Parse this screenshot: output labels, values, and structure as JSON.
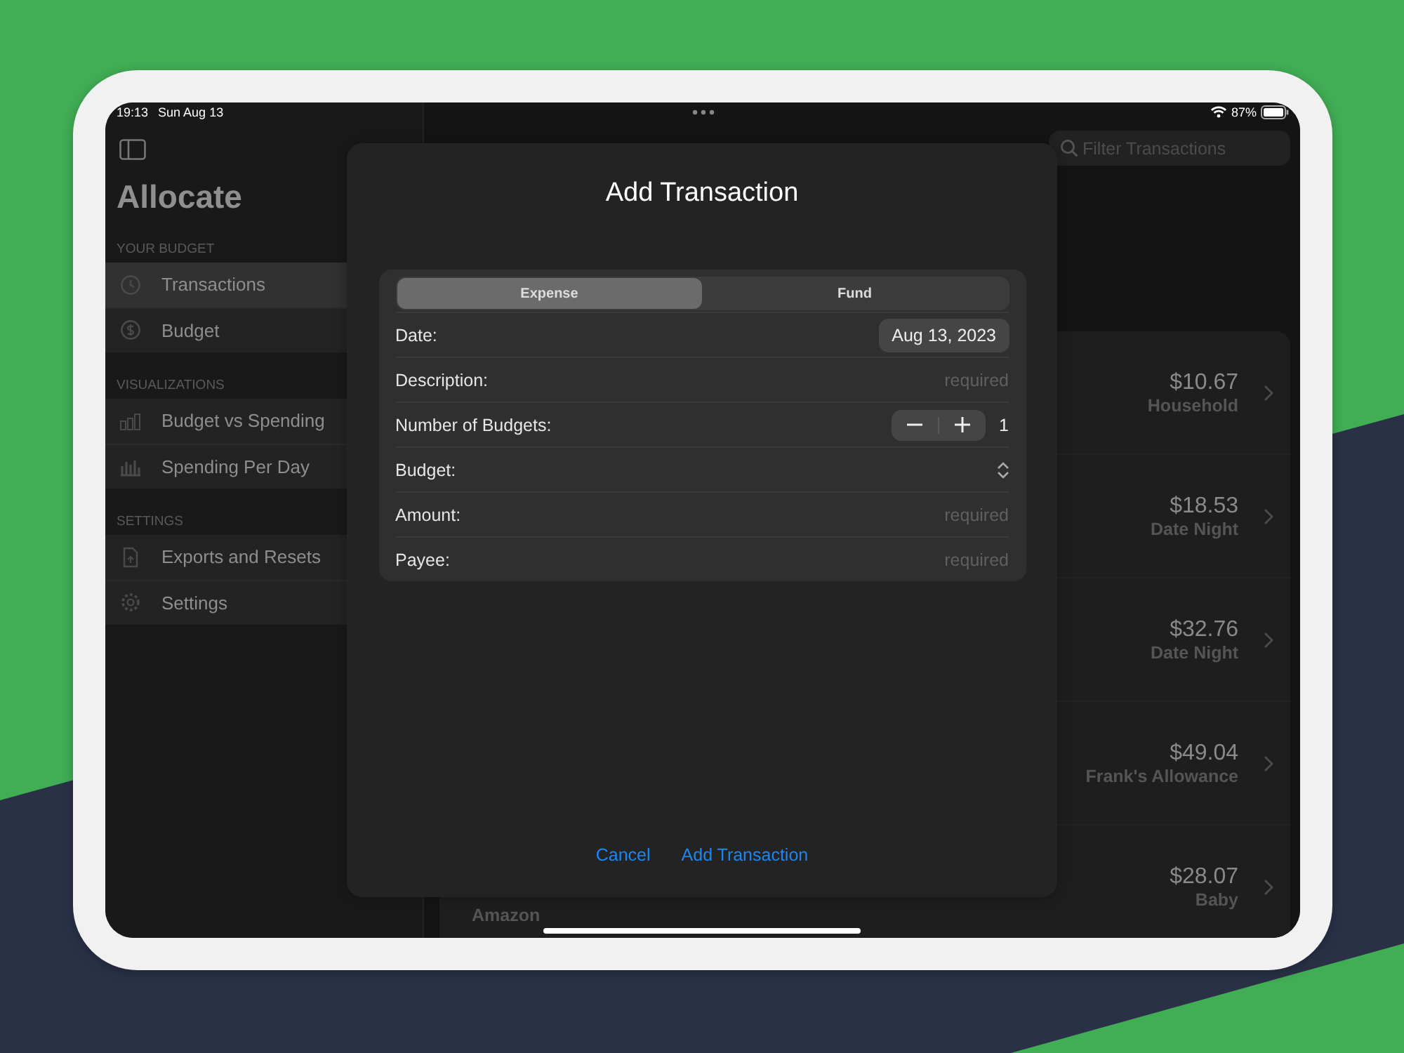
{
  "status_bar": {
    "time": "19:13",
    "date": "Sun Aug 13",
    "battery": "87%"
  },
  "sidebar": {
    "title": "Allocate",
    "sections": [
      {
        "header": "YOUR BUDGET",
        "items": [
          {
            "label": "Transactions",
            "selected": true
          },
          {
            "label": "Budget",
            "selected": false
          }
        ]
      },
      {
        "header": "VISUALIZATIONS",
        "items": [
          {
            "label": "Budget vs Spending",
            "selected": false
          },
          {
            "label": "Spending Per Day",
            "selected": false
          }
        ]
      },
      {
        "header": "SETTINGS",
        "items": [
          {
            "label": "Exports and Resets",
            "selected": false
          },
          {
            "label": "Settings",
            "selected": false
          }
        ]
      }
    ]
  },
  "search": {
    "placeholder": "Filter Transactions"
  },
  "transactions": [
    {
      "amount": "$10.67",
      "budget": "Household"
    },
    {
      "amount": "$18.53",
      "budget": "Date Night"
    },
    {
      "amount": "$32.76",
      "budget": "Date Night"
    },
    {
      "amount": "$49.04",
      "budget": "Frank's Allowance"
    },
    {
      "payee": "Amazon",
      "amount": "$28.07",
      "budget": "Baby"
    }
  ],
  "modal": {
    "title": "Add Transaction",
    "segments": [
      {
        "label": "Expense",
        "selected": true
      },
      {
        "label": "Fund",
        "selected": false
      }
    ],
    "rows": [
      {
        "kind": "date",
        "label": "Date:",
        "value": "Aug 13, 2023"
      },
      {
        "kind": "text",
        "label": "Description:",
        "placeholder": "required"
      },
      {
        "kind": "stepper",
        "label": "Number of Budgets:",
        "value": "1"
      },
      {
        "kind": "picker",
        "label": "Budget:"
      },
      {
        "kind": "text",
        "label": "Amount:",
        "placeholder": "required"
      },
      {
        "kind": "text",
        "label": "Payee:",
        "placeholder": "required"
      }
    ],
    "buttons": [
      "Cancel",
      "Add Transaction"
    ]
  }
}
